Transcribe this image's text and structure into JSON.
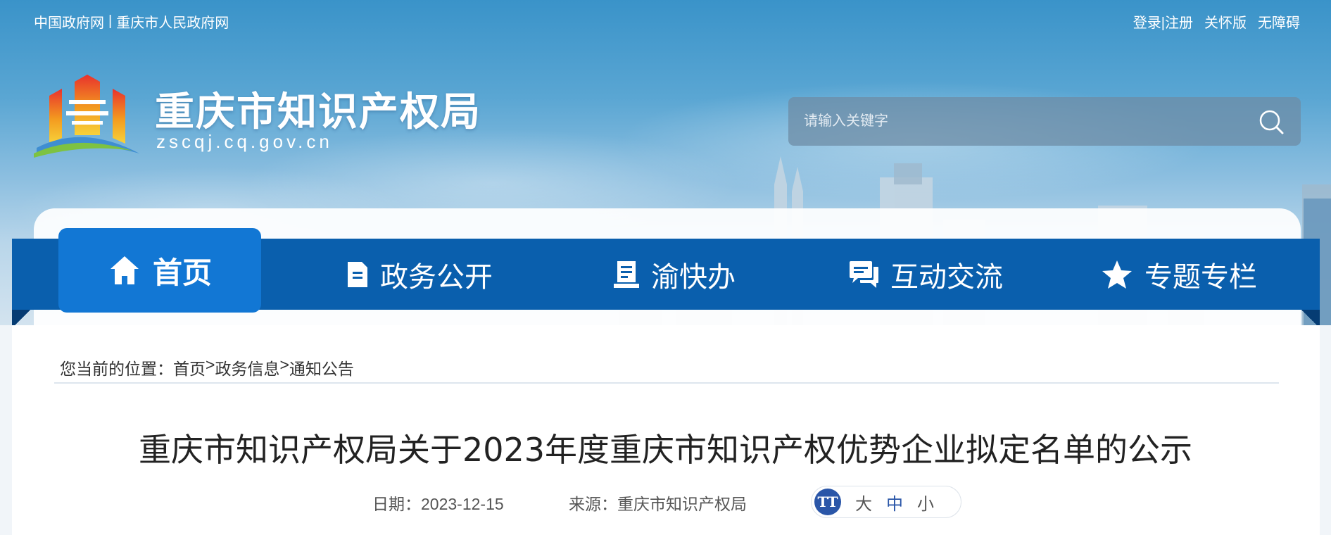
{
  "top_links": {
    "gov_cn": "中国政府网",
    "separator": "|",
    "cq_gov": "重庆市人民政府网"
  },
  "top_right": {
    "login_register": "登录|注册",
    "care_mode": "关怀版",
    "accessibility": "无障碍"
  },
  "site": {
    "title": "重庆市知识产权局",
    "domain": "zscqj.cq.gov.cn"
  },
  "search": {
    "placeholder": "请输入关键字",
    "icon": "search-icon"
  },
  "nav": [
    {
      "label": "首页",
      "icon": "home-icon",
      "active": true
    },
    {
      "label": "政务公开",
      "icon": "document-icon",
      "active": false
    },
    {
      "label": "渝快办",
      "icon": "desk-icon",
      "active": false
    },
    {
      "label": "互动交流",
      "icon": "chat-icon",
      "active": false
    },
    {
      "label": "专题专栏",
      "icon": "star-icon",
      "active": false
    }
  ],
  "breadcrumb": {
    "prefix": "您当前的位置：",
    "items": [
      "首页",
      "政务信息",
      "通知公告"
    ],
    "separator": ">"
  },
  "article": {
    "title": "重庆市知识产权局关于2023年度重庆市知识产权优势企业拟定名单的公示",
    "date_label": "日期：2023-12-15",
    "source_label": "来源：重庆市知识产权局"
  },
  "font_size": {
    "icon_text": "TT",
    "large": "大",
    "medium": "中",
    "small": "小"
  },
  "colors": {
    "nav_bg": "#0a5fad",
    "nav_active": "#1277d4",
    "accent": "#2a56a8"
  }
}
